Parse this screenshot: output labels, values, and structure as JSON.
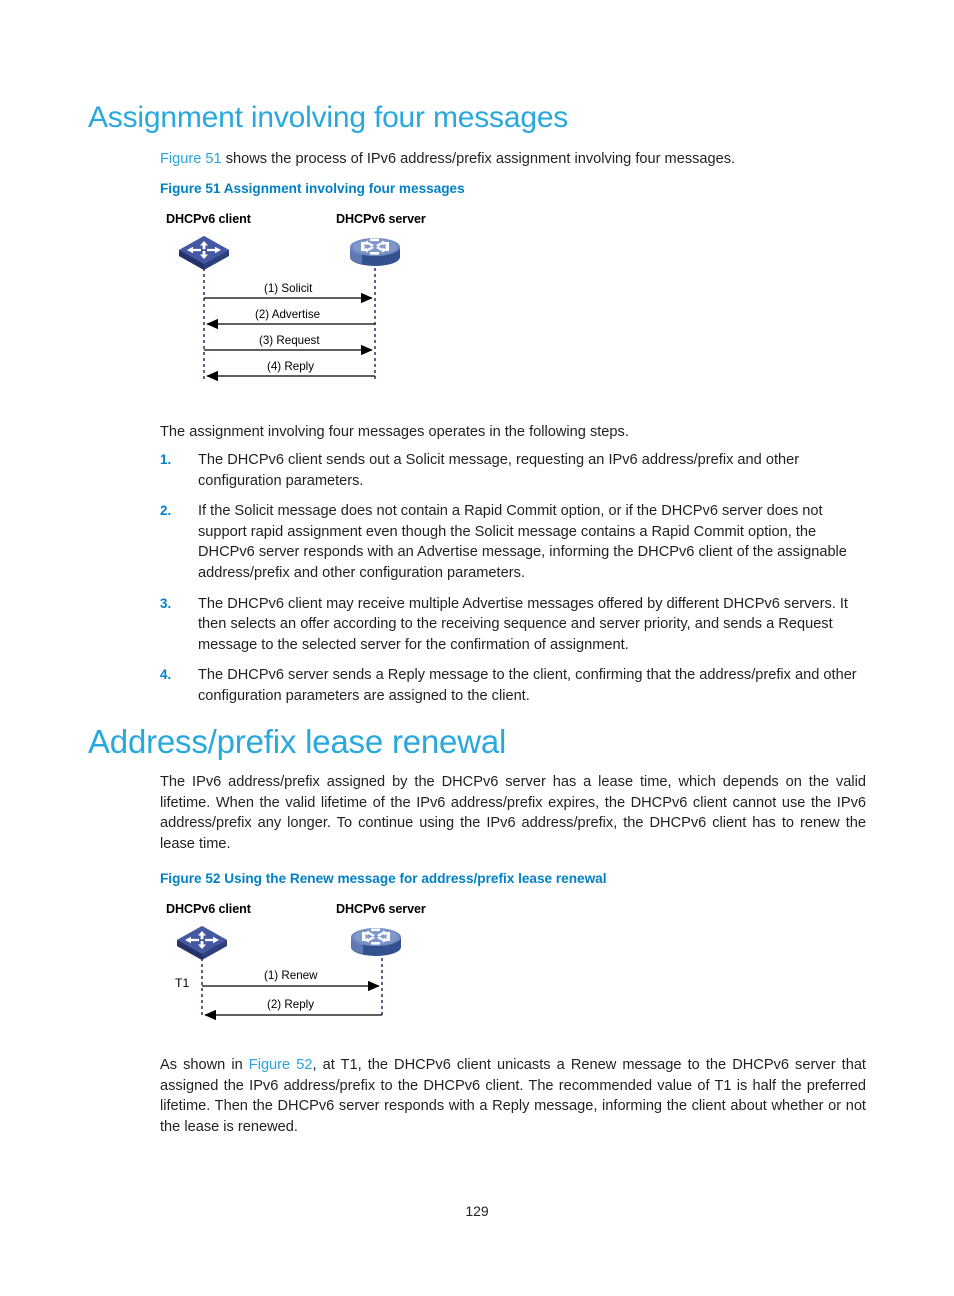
{
  "page": {
    "number": "129"
  },
  "section1": {
    "heading": "Assignment involving four messages",
    "intro_prefix": "",
    "intro_xref": "Figure 51",
    "intro_rest": " shows the process of IPv6 address/prefix assignment involving four messages.",
    "figure_caption": "Figure 51 Assignment involving four messages",
    "lead_in": "The assignment involving four messages operates in the following steps.",
    "steps": [
      {
        "num": "1.",
        "text": "The DHCPv6 client sends out a Solicit message, requesting an IPv6 address/prefix and other configuration parameters."
      },
      {
        "num": "2.",
        "text": "If the Solicit message does not contain a Rapid Commit option, or if the DHCPv6 server does not support rapid assignment even though the Solicit message contains a Rapid Commit option, the DHCPv6 server responds with an Advertise message, informing the DHCPv6 client of the assignable address/prefix and other configuration parameters."
      },
      {
        "num": "3.",
        "text": "The DHCPv6 client may receive multiple Advertise messages offered by different DHCPv6 servers. It then selects an offer according to the receiving sequence and server priority, and sends a Request message to the selected server for the confirmation of assignment."
      },
      {
        "num": "4.",
        "text": "The DHCPv6 server sends a Reply message to the client, confirming that the address/prefix and other configuration parameters are assigned to the client."
      }
    ]
  },
  "figure51": {
    "client_label": "DHCPv6 client",
    "server_label": "DHCPv6 server",
    "client_icon": "router-icon",
    "server_icon": "switch-icon",
    "messages": [
      {
        "label": "(1) Solicit",
        "direction": "right"
      },
      {
        "label": "(2) Advertise",
        "direction": "left"
      },
      {
        "label": "(3) Request",
        "direction": "right"
      },
      {
        "label": "(4) Reply",
        "direction": "left"
      }
    ]
  },
  "section2": {
    "heading": "Address/prefix lease renewal",
    "paragraph": "The IPv6 address/prefix assigned by the DHCPv6 server has a lease time, which depends on the valid lifetime. When the valid lifetime of the IPv6 address/prefix expires, the DHCPv6 client cannot use the IPv6 address/prefix any longer. To continue using the IPv6 address/prefix, the DHCPv6 client has to renew the lease time.",
    "figure_caption": "Figure 52 Using the Renew message for address/prefix lease renewal",
    "closing_prefix": "As shown in ",
    "closing_xref": "Figure 52",
    "closing_rest": ", at T1, the DHCPv6 client unicasts a Renew message to the DHCPv6 server that assigned the IPv6 address/prefix to the DHCPv6 client. The recommended value of T1 is half the preferred lifetime. Then the DHCPv6 server responds with a Reply message, informing the client about whether or not the lease is renewed."
  },
  "figure52": {
    "client_label": "DHCPv6 client",
    "server_label": "DHCPv6 server",
    "client_icon": "router-icon",
    "server_icon": "switch-icon",
    "time_marker": "T1",
    "messages": [
      {
        "label": "(1) Renew",
        "direction": "right"
      },
      {
        "label": "(2) Reply",
        "direction": "left"
      }
    ]
  },
  "colors": {
    "heading_blue": "#29a8de",
    "caption_blue": "#0081c6",
    "xref_blue": "#2ba3dd",
    "body_black": "#231f20",
    "device_blue_dark": "#3b4d92",
    "device_blue_light": "#7f96c4",
    "lifeline_navy": "#1b1f5e"
  }
}
